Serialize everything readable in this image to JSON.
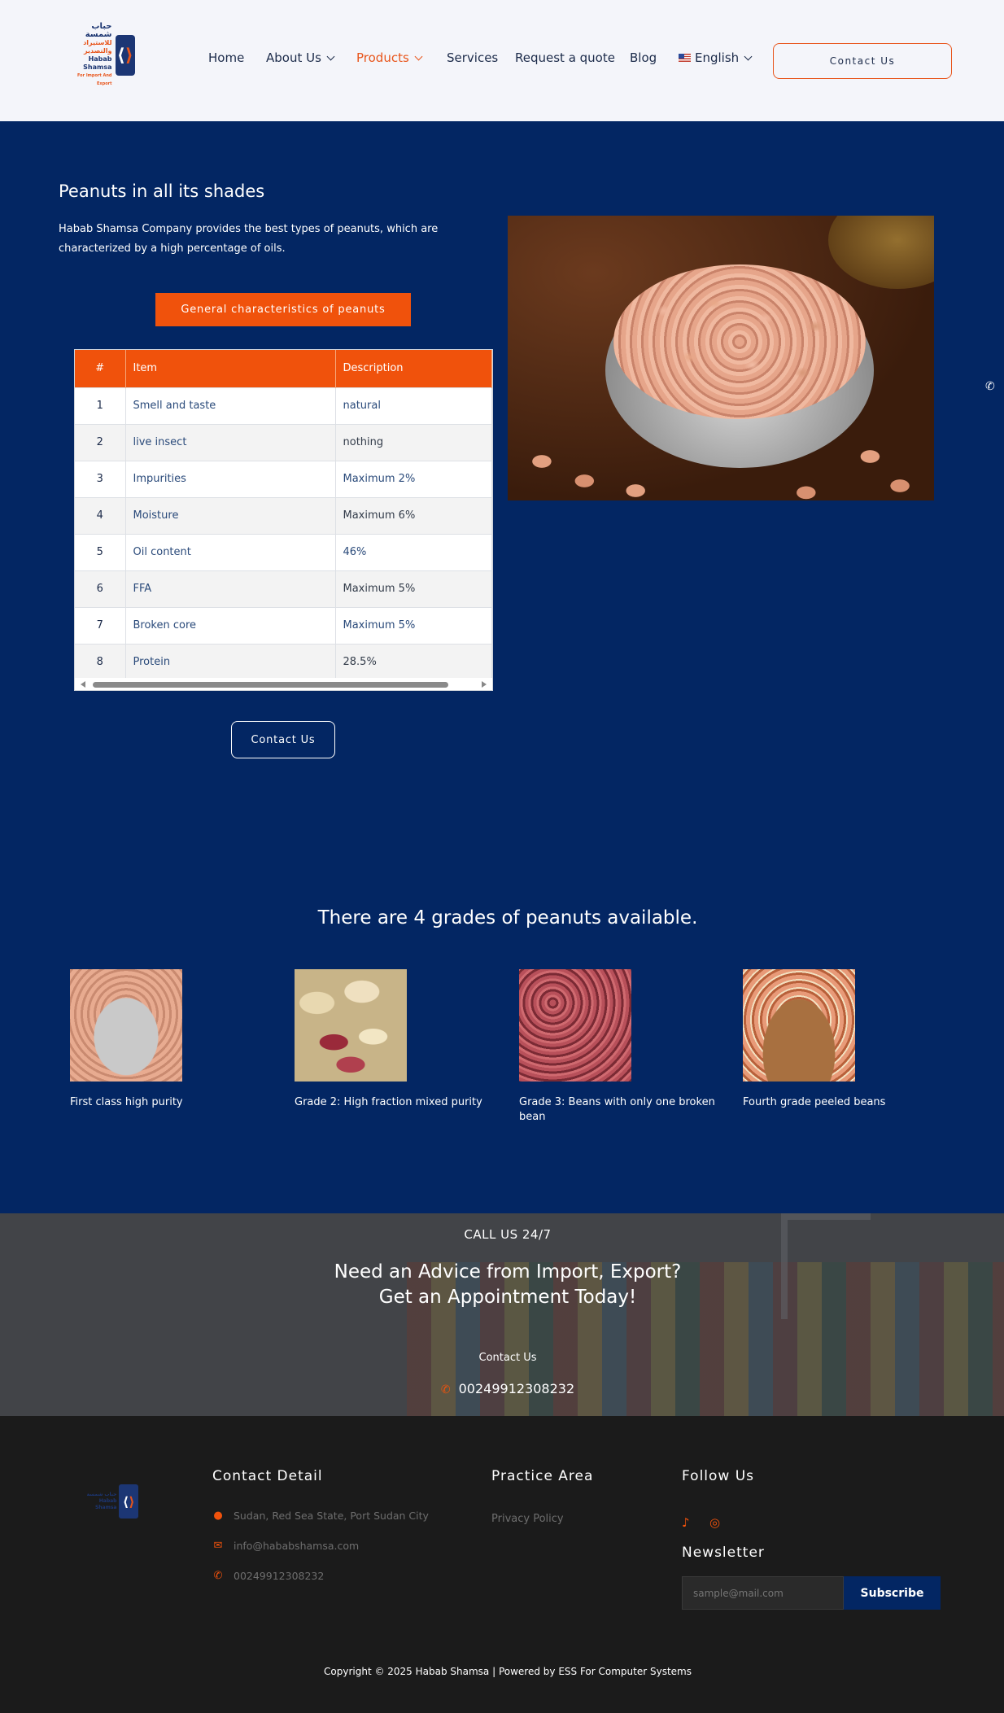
{
  "header": {
    "logo": {
      "arabic_1": "حباب شمسة",
      "arabic_2": "للاستيراد والتصدير",
      "name": "Habab Shamsa",
      "tagline": "For Import And Export"
    },
    "nav": [
      {
        "label": "Home",
        "active": false,
        "dropdown": false
      },
      {
        "label": "About Us",
        "active": false,
        "dropdown": true
      },
      {
        "label": "Products",
        "active": true,
        "dropdown": true
      },
      {
        "label": "Services",
        "active": false,
        "dropdown": false
      },
      {
        "label": "Request a quote",
        "active": false,
        "dropdown": false
      },
      {
        "label": "Blog",
        "active": false,
        "dropdown": false
      },
      {
        "label": "English",
        "active": false,
        "dropdown": true
      }
    ],
    "contact_button": "Contact Us"
  },
  "product": {
    "title": "Peanuts in all its shades",
    "intro": "Habab Shamsa Company provides the best types of peanuts, which are characterized by a high percentage of oils.",
    "characteristics_button": "General characteristics of peanuts",
    "table": {
      "headers": [
        "#",
        "Item",
        "Description"
      ],
      "rows": [
        [
          "1",
          "Smell and taste",
          "natural"
        ],
        [
          "2",
          "live insect",
          "nothing"
        ],
        [
          "3",
          "Impurities",
          "Maximum 2%"
        ],
        [
          "4",
          "Moisture",
          "Maximum 6%"
        ],
        [
          "5",
          "Oil content",
          "46%"
        ],
        [
          "6",
          "FFA",
          "Maximum 5%"
        ],
        [
          "7",
          "Broken core",
          "Maximum 5%"
        ],
        [
          "8",
          "Protein",
          "28.5%"
        ]
      ]
    },
    "contact_button": "Contact Us"
  },
  "grades": {
    "title": "There are 4 grades of peanuts available.",
    "items": [
      {
        "caption": "First class high purity"
      },
      {
        "caption": "Grade 2: High fraction mixed purity"
      },
      {
        "caption": "Grade 3: Beans with only one broken bean"
      },
      {
        "caption": "Fourth grade peeled beans"
      }
    ]
  },
  "cta": {
    "eyebrow": "CALL US 24/7",
    "title_line1": "Need an Advice from Import, Export?",
    "title_line2": "Get an Appointment Today!",
    "link": "Contact Us",
    "phone": "00249912308232"
  },
  "footer": {
    "contact_heading": "Contact Detail",
    "address": "Sudan, Red Sea State, Port Sudan City",
    "email": "info@hababshamsa.com",
    "phone": "00249912308232",
    "practice_heading": "Practice Area",
    "practice_link": "Privacy Policy",
    "follow_heading": "Follow Us",
    "social_icons": [
      "tiktok-icon",
      "instagram-icon"
    ],
    "newsletter_heading": "Newsletter",
    "newsletter_placeholder": "sample@mail.com",
    "subscribe_button": "Subscribe",
    "copyright": "Copyright © 2025 Habab Shamsa | Powered by ESS For Computer Systems"
  },
  "colors": {
    "navy": "#032663",
    "orange": "#f0520c",
    "footer_bg": "#1b1b1b",
    "header_bg": "#f4f5fa"
  }
}
